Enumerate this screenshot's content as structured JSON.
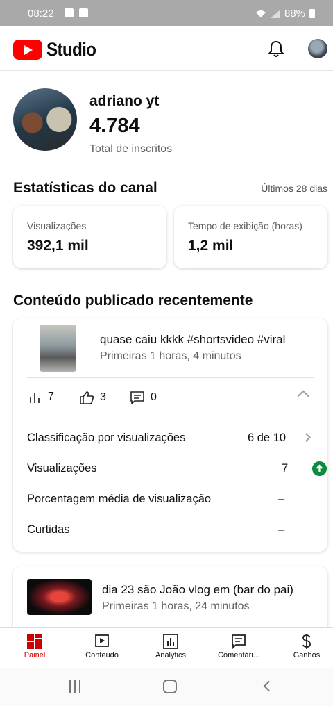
{
  "status_bar": {
    "time": "08:22",
    "battery": "88%"
  },
  "app": {
    "name": "Studio"
  },
  "channel": {
    "name": "adriano yt",
    "subscribers": "4.784",
    "subscribers_label": "Total de inscritos"
  },
  "stats": {
    "title": "Estatísticas do canal",
    "period": "Últimos 28 dias",
    "cards": [
      {
        "label": "Visualizações",
        "value": "392,1 mil"
      },
      {
        "label": "Tempo de exibição (horas)",
        "value": "1,2 mil"
      }
    ]
  },
  "recent": {
    "title": "Conteúdo publicado recentemente",
    "videos": [
      {
        "title": "quase caiu kkkk #shortsvideo #viral",
        "subtitle": "Primeiras 1 horas, 4 minutos",
        "views": "7",
        "likes": "3",
        "comments": "0",
        "details": [
          {
            "label": "Classificação por visualizações",
            "value": "6 de 10"
          },
          {
            "label": "Visualizações",
            "value": "7"
          },
          {
            "label": "Porcentagem média de visualização",
            "value": "–"
          },
          {
            "label": "Curtidas",
            "value": "–"
          }
        ]
      },
      {
        "title": "dia 23 são João vlog em (bar do pai)",
        "subtitle": "Primeiras 1 horas, 24 minutos"
      }
    ]
  },
  "nav": [
    {
      "label": "Painel",
      "icon": "dashboard-icon",
      "active": true
    },
    {
      "label": "Conteúdo",
      "icon": "content-icon"
    },
    {
      "label": "Analytics",
      "icon": "analytics-icon"
    },
    {
      "label": "Comentári...",
      "icon": "comments-icon"
    },
    {
      "label": "Ganhos",
      "icon": "earnings-icon"
    }
  ],
  "colors": {
    "brand_red": "#ff0000",
    "active_nav": "#cc0000",
    "trend_up": "#0f8a3c"
  }
}
